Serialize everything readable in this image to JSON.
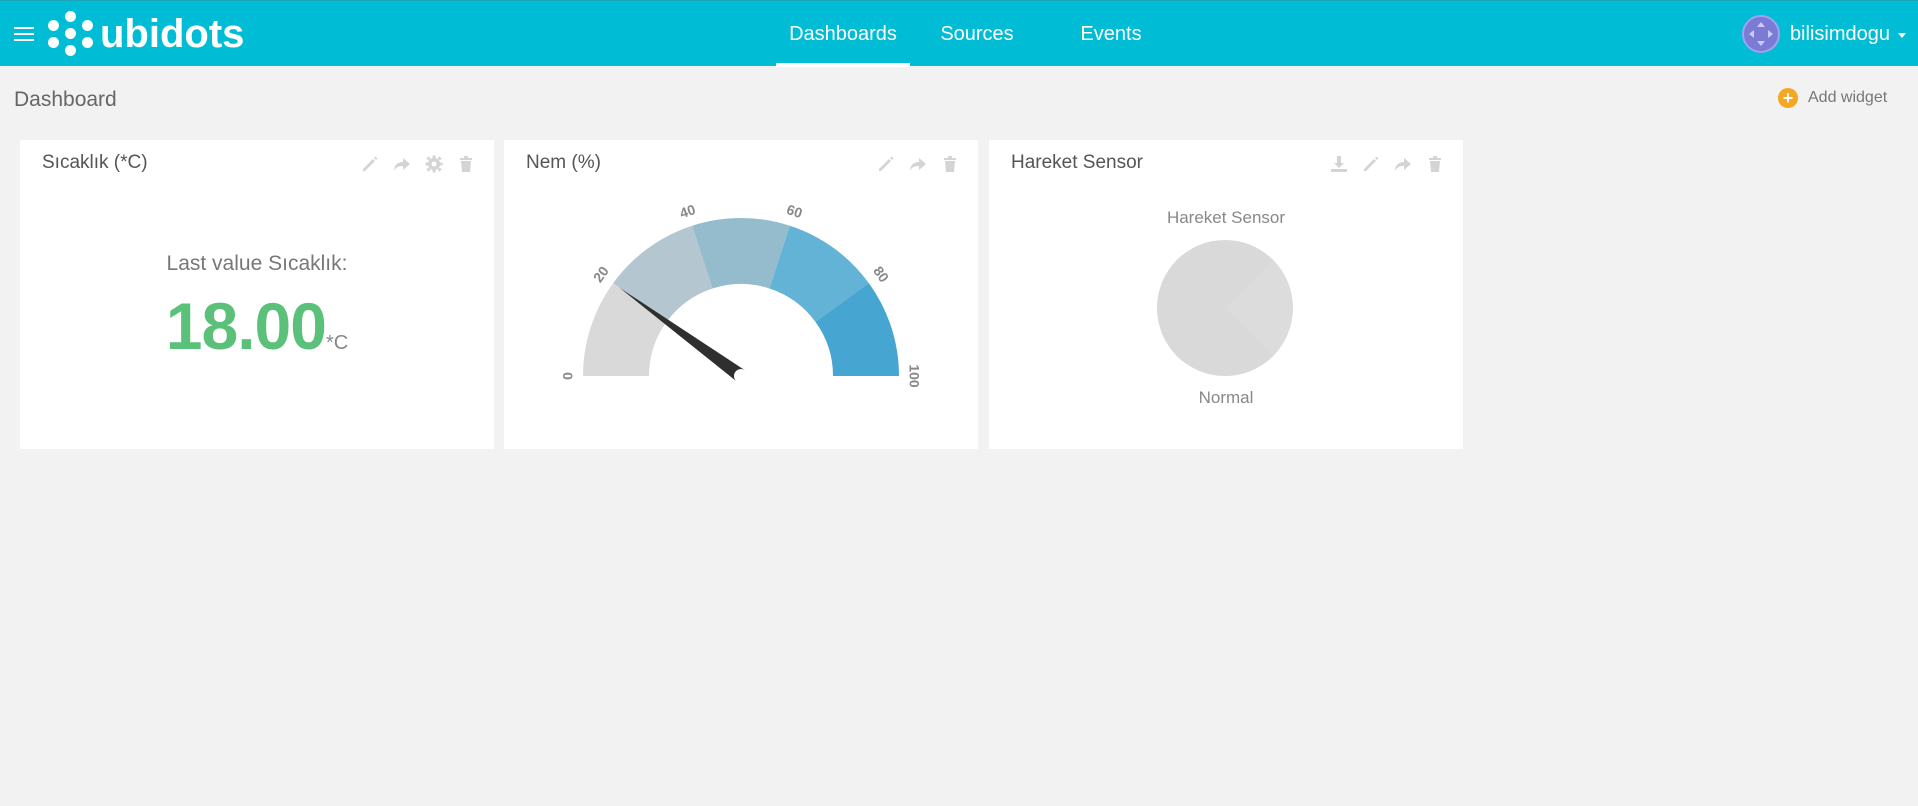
{
  "app": {
    "brand": "ubidots"
  },
  "nav": {
    "items": [
      {
        "label": "Dashboards",
        "active": true
      },
      {
        "label": "Sources",
        "active": false
      },
      {
        "label": "Events",
        "active": false
      }
    ]
  },
  "user": {
    "name": "bilisimdogu"
  },
  "page": {
    "title": "Dashboard",
    "add_widget_label": "Add widget"
  },
  "widgets": {
    "temperature": {
      "title": "Sıcaklık (*C)",
      "label": "Last value Sıcaklık:",
      "value": "18.00",
      "unit": "*C"
    },
    "humidity": {
      "title": "Nem (%)",
      "gauge": {
        "min": 0,
        "max": 100,
        "value": 20,
        "ticks": [
          "0",
          "20",
          "40",
          "60",
          "80",
          "100"
        ],
        "band_colors": [
          "#d9d9d9",
          "#b4c6d0",
          "#94bccd",
          "#63b3d6",
          "#46a5d1"
        ]
      }
    },
    "motion": {
      "title": "Hareket Sensor",
      "label": "Hareket Sensor",
      "status": "Normal",
      "indicator_color": "#d9d9d9"
    }
  },
  "colors": {
    "topbar": "#00bcd4",
    "accent_add": "#f5a623",
    "value_green": "#5ac07a"
  },
  "icons": {
    "widget_tools": [
      "pencil-icon",
      "share-icon",
      "gear-icon",
      "trash-icon",
      "download-icon"
    ]
  }
}
